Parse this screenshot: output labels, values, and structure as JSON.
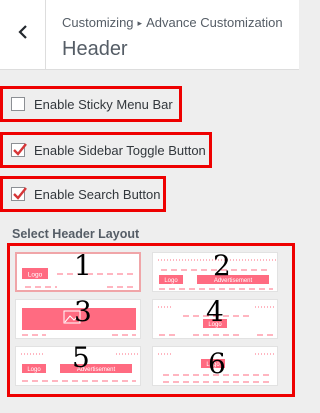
{
  "header": {
    "breadcrumb_root": "Customizing",
    "breadcrumb_separator": "▸",
    "breadcrumb_current": "Advance Customization",
    "title": "Header",
    "back_icon": "chevron-left-icon"
  },
  "options": [
    {
      "label": "Enable Sticky Menu Bar",
      "checked": false
    },
    {
      "label": "Enable Sidebar Toggle Button",
      "checked": true
    },
    {
      "label": "Enable Search Button",
      "checked": true
    }
  ],
  "layout_section": {
    "title": "Select Header Layout",
    "selected": 1,
    "layouts": [
      {
        "number": "1",
        "logo_text": "Logo",
        "ad_text": ""
      },
      {
        "number": "2",
        "logo_text": "Logo",
        "ad_text": "Advertisement"
      },
      {
        "number": "3",
        "logo_text": "",
        "ad_text": ""
      },
      {
        "number": "4",
        "logo_text": "Logo",
        "ad_text": ""
      },
      {
        "number": "5",
        "logo_text": "Logo",
        "ad_text": "Advertisement"
      },
      {
        "number": "6",
        "logo_text": "Logo",
        "ad_text": ""
      }
    ]
  },
  "colors": {
    "accent": "#ff6b81",
    "annotation_red": "#ee0000",
    "check": "#d63638"
  }
}
